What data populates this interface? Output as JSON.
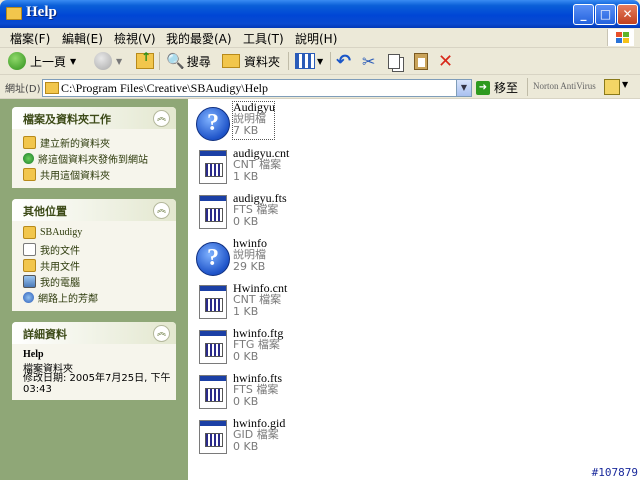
{
  "window": {
    "title": "Help"
  },
  "menu": [
    "檔案(F)",
    "編輯(E)",
    "檢視(V)",
    "我的最愛(A)",
    "工具(T)",
    "說明(H)"
  ],
  "toolbar": {
    "back": "上一頁",
    "search": "搜尋",
    "folders": "資料夾"
  },
  "address": {
    "label": "網址(D)",
    "path": "C:\\Program Files\\Creative\\SBAudigy\\Help",
    "go": "移至",
    "plugin": "Norton AntiVirus"
  },
  "tasks_panel": {
    "title": "檔案及資料夾工作",
    "items": [
      "建立新的資料夾",
      "將這個資料夾發佈到網站",
      "共用這個資料夾"
    ]
  },
  "places_panel": {
    "title": "其他位置",
    "items": [
      "SBAudigy",
      "我的文件",
      "共用文件",
      "我的電腦",
      "網路上的芳鄰"
    ]
  },
  "details_panel": {
    "title": "詳細資料",
    "name": "Help",
    "type": "檔案資料夾",
    "modified": "修改日期: 2005年7月25日, 下午 03:43"
  },
  "files": [
    {
      "name": "Audigyu",
      "type": "說明檔",
      "size": "7 KB",
      "icon": "help-file-icon"
    },
    {
      "name": "audigyu.cnt",
      "type": "CNT 檔案",
      "size": "1 KB",
      "icon": "document-icon"
    },
    {
      "name": "audigyu.fts",
      "type": "FTS 檔案",
      "size": "0 KB",
      "icon": "document-icon"
    },
    {
      "name": "hwinfo",
      "type": "說明檔",
      "size": "29 KB",
      "icon": "help-file-icon"
    },
    {
      "name": "Hwinfo.cnt",
      "type": "CNT 檔案",
      "size": "1 KB",
      "icon": "document-icon"
    },
    {
      "name": "hwinfo.ftg",
      "type": "FTG 檔案",
      "size": "0 KB",
      "icon": "document-icon"
    },
    {
      "name": "hwinfo.fts",
      "type": "FTS 檔案",
      "size": "0 KB",
      "icon": "document-icon"
    },
    {
      "name": "hwinfo.gid",
      "type": "GID 檔案",
      "size": "0 KB",
      "icon": "document-icon"
    }
  ],
  "watermark": "#107879"
}
